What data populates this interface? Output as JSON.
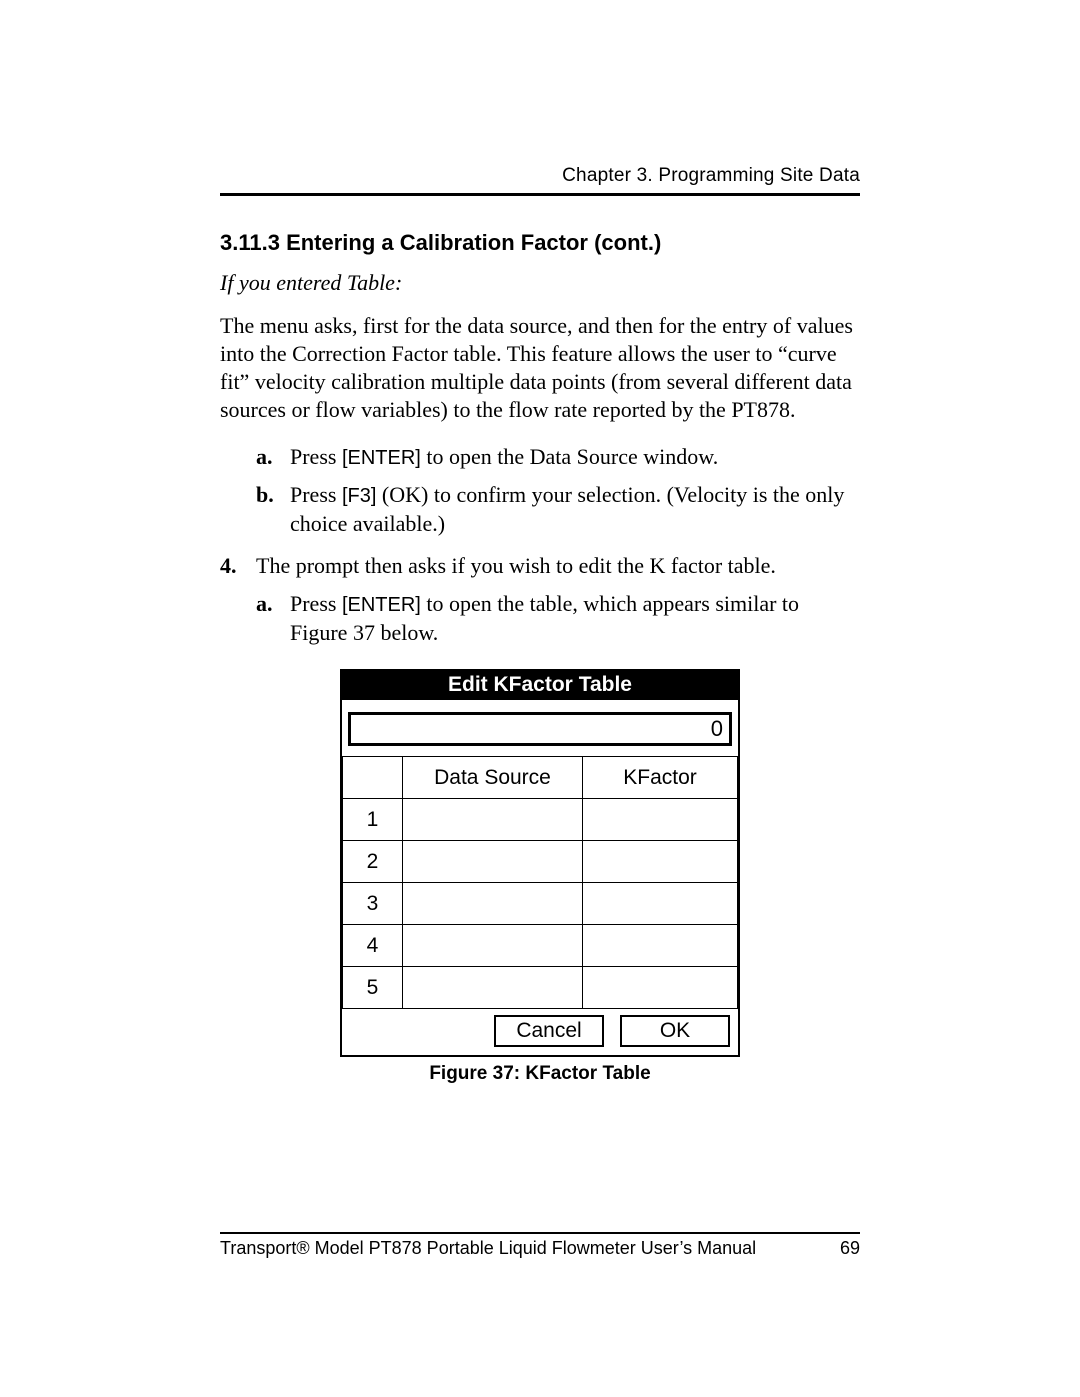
{
  "header": {
    "chapter": "Chapter 3. Programming Site Data"
  },
  "section": {
    "number_title": "3.11.3  Entering a Calibration Factor (cont.)",
    "subhead": "If you entered Table:",
    "para1": "The menu asks, first for the data source, and then for the entry of values into the Correction Factor table. This feature allows the user to “curve fit” velocity calibration multiple data points (from several different data sources or flow variables) to the flow rate reported by the PT878."
  },
  "steps": {
    "a_text_pre": "Press ",
    "a_key": "[ENTER]",
    "a_text_post": " to open the Data Source window.",
    "b_text_pre": "Press ",
    "b_key": "[F3]",
    "b_text_post": " (OK) to confirm your selection. (Velocity is the only choice available.)",
    "step4_text": "The prompt then asks if you wish to edit the K factor table.",
    "step4a_pre": "Press ",
    "step4a_key": "[ENTER]",
    "step4a_post": " to open the table, which appears similar to Figure 37 below."
  },
  "markers": {
    "a": "a.",
    "b": "b.",
    "n4": "4."
  },
  "dialog": {
    "title": "Edit KFactor Table",
    "value": "0",
    "headers": {
      "idx": "",
      "ds": "Data Source",
      "kf": "KFactor"
    },
    "rows": [
      {
        "idx": "1",
        "ds": "",
        "kf": ""
      },
      {
        "idx": "2",
        "ds": "",
        "kf": ""
      },
      {
        "idx": "3",
        "ds": "",
        "kf": ""
      },
      {
        "idx": "4",
        "ds": "",
        "kf": ""
      },
      {
        "idx": "5",
        "ds": "",
        "kf": ""
      }
    ],
    "buttons": {
      "cancel": "Cancel",
      "ok": "OK"
    }
  },
  "figure_caption": "Figure 37: KFactor Table",
  "footer": {
    "left": "Transport® Model PT878 Portable Liquid Flowmeter User’s Manual",
    "right": "69"
  }
}
